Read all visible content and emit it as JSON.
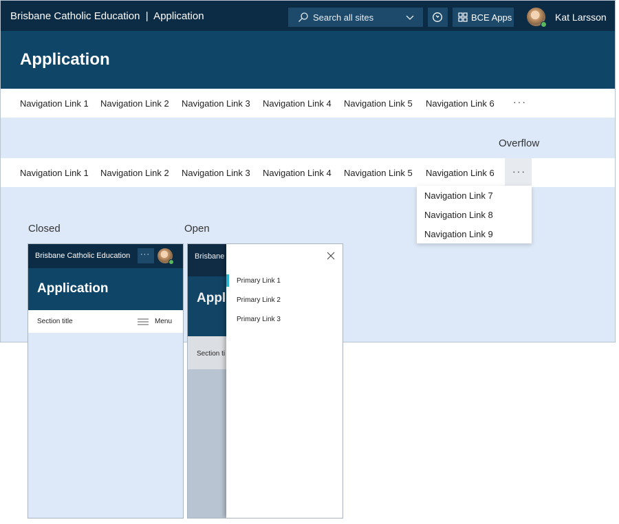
{
  "suitebar": {
    "title": "Brisbane Catholic Education  |  Application",
    "search_placeholder": "Search all sites",
    "apps_label": "BCE Apps",
    "user_name": "Kat Larsson"
  },
  "appbar": {
    "title": "Application"
  },
  "nav": {
    "links": [
      "Navigation Link 1",
      "Navigation Link 2",
      "Navigation Link 3",
      "Navigation Link 4",
      "Navigation Link 5",
      "Navigation Link 6"
    ],
    "more": "···"
  },
  "overflow": {
    "label": "Overflow",
    "items": [
      "Navigation Link 7",
      "Navigation Link 8",
      "Navigation Link 9"
    ]
  },
  "mobile_closed": {
    "label": "Closed",
    "top_title": "Brisbane Catholic Education",
    "more": "···",
    "app_title": "Application",
    "section_title": "Section title",
    "menu_label": "Menu"
  },
  "mobile_open": {
    "label": "Open",
    "top_title": "Brisbane",
    "app_title": "Appl",
    "section_title": "Section ti",
    "primary_links": [
      "Primary Link 1",
      "Primary Link 2",
      "Primary Link 3"
    ]
  },
  "colors": {
    "suitebar": "#0c2b45",
    "appbar": "#0f4668",
    "background": "#dde9f8",
    "accent": "#29b6d3",
    "presence": "#5cb85c"
  }
}
